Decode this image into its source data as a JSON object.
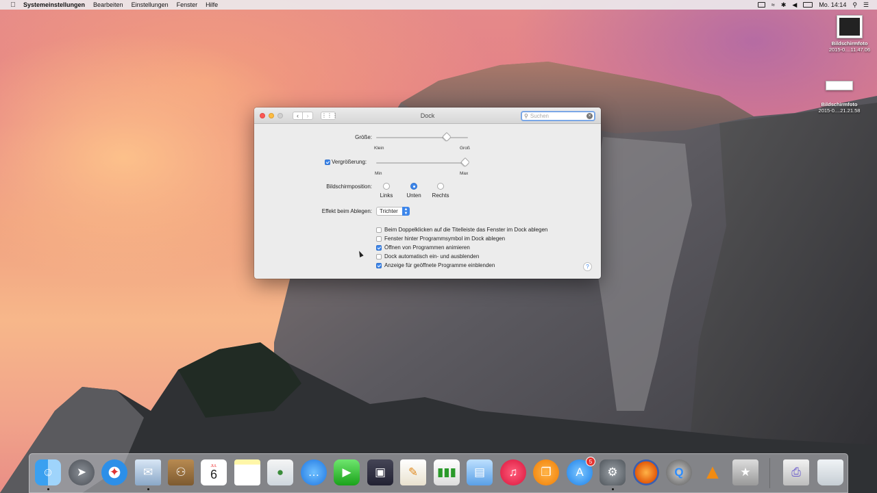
{
  "menubar": {
    "app_name": "Systemeinstellungen",
    "items": [
      "Bearbeiten",
      "Einstellungen",
      "Fenster",
      "Hilfe"
    ],
    "clock": "Mo. 14:14"
  },
  "desktop": {
    "items": [
      {
        "label": "Bildschirmfoto",
        "sub": "2015-0....11.47.06"
      },
      {
        "label": "Bildschirmfoto",
        "sub": "2015-0....21.21.58"
      }
    ]
  },
  "window": {
    "title": "Dock",
    "search_placeholder": "Suchen",
    "size": {
      "label": "Größe:",
      "min": "Klein",
      "max": "Groß",
      "value": 0.75
    },
    "magnification": {
      "label": "Vergrößerung:",
      "checked": true,
      "min": "Min",
      "max": "Max",
      "value": 0.97
    },
    "position": {
      "label": "Bildschirmposition:",
      "options": [
        "Links",
        "Unten",
        "Rechts"
      ],
      "selected": "Unten"
    },
    "minimize_effect": {
      "label": "Effekt beim Ablegen:",
      "value": "Trichter"
    },
    "checkboxes": [
      {
        "label": "Beim Doppelklicken auf die Titelleiste das Fenster im Dock ablegen",
        "checked": false
      },
      {
        "label": "Fenster hinter Programmsymbol im Dock ablegen",
        "checked": false
      },
      {
        "label": "Öffnen von Programmen animieren",
        "checked": true
      },
      {
        "label": "Dock automatisch ein- und ausblenden",
        "checked": false
      },
      {
        "label": "Anzeige für geöffnete Programme einblenden",
        "checked": true
      }
    ],
    "help": "?"
  },
  "dock": {
    "calendar_day": "6",
    "calendar_month": "JUL",
    "appstore_badge": "5"
  }
}
